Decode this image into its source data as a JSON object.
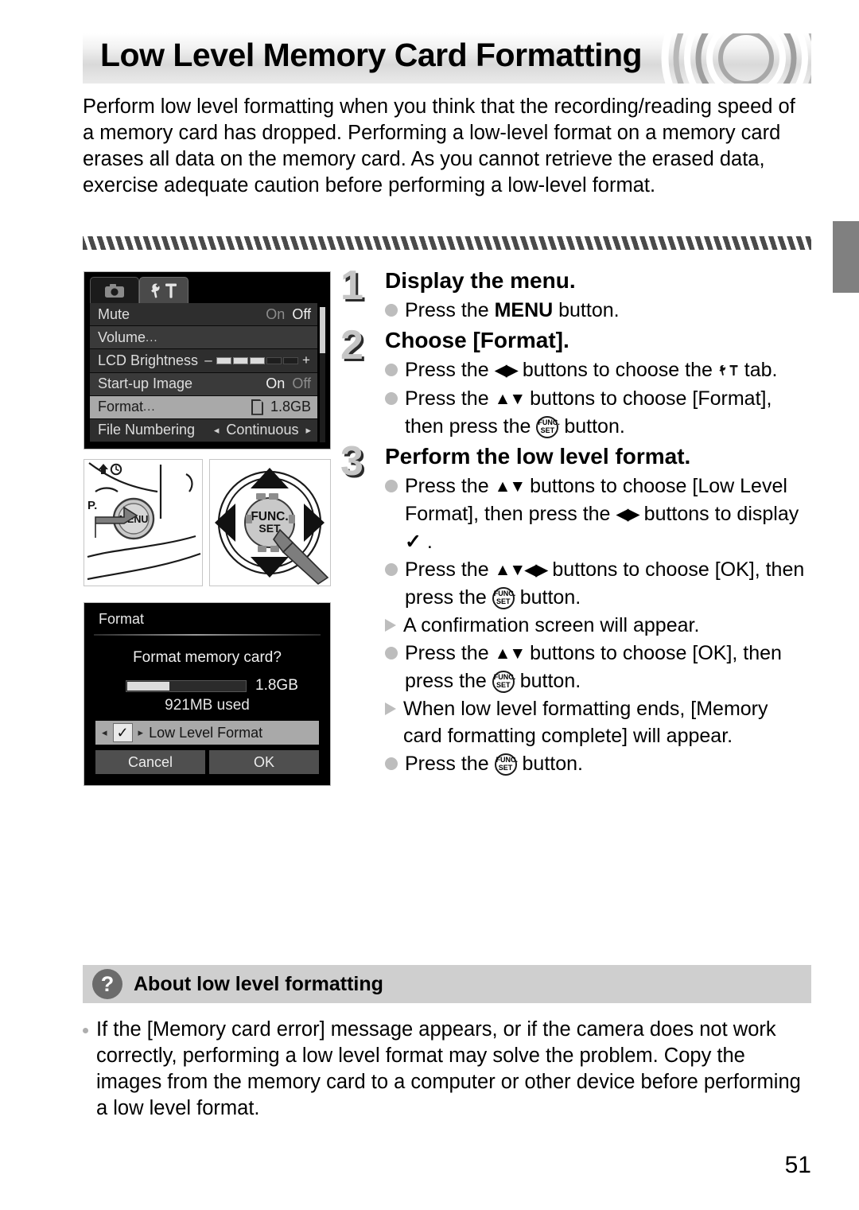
{
  "header": {
    "title": "Low Level Memory Card Formatting"
  },
  "intro": "Perform low level formatting when you think that the recording/reading speed of a memory card has dropped. Performing a low-level format on a memory card erases all data on the memory card. As you cannot retrieve the erased data, exercise adequate caution before performing a low-level format.",
  "menu_screen": {
    "tabs": [
      {
        "icon": "camera-icon",
        "active": false
      },
      {
        "icon": "tools-icon",
        "active": true
      }
    ],
    "rows": [
      {
        "label": "Mute",
        "value_on": "On",
        "value_off": "Off",
        "selected": "Off"
      },
      {
        "label": "Volume",
        "ellipsis": "..."
      },
      {
        "label": "LCD Brightness",
        "minus": "–",
        "plus": "+",
        "segments_lit": 3,
        "segments_total": 5
      },
      {
        "label": "Start-up Image",
        "value_on": "On",
        "value_off": "Off",
        "selected": "On"
      },
      {
        "label": "Format",
        "ellipsis": "...",
        "value": "1.8GB",
        "icon": "sd-card-icon",
        "highlighted": true
      },
      {
        "label": "File Numbering",
        "value": "Continuous",
        "left_arrow": "◂",
        "right_arrow": "▸"
      }
    ]
  },
  "illustrations": {
    "menu_button": {
      "name": "camera-back-menu-button",
      "label": "MENU",
      "mode_label": "P."
    },
    "func_button": {
      "name": "camera-four-way-controller",
      "label_top": "FUNC.",
      "label_bottom": "SET"
    }
  },
  "format_screen": {
    "title": "Format",
    "question": "Format memory card?",
    "capacity": "1.8GB",
    "used": "921MB used",
    "low_level_label": "Low Level Format",
    "check_glyph": "✓",
    "left_arrow": "◂",
    "right_arrow": "▸",
    "cancel": "Cancel",
    "ok": "OK",
    "bar_fill_percent": 35
  },
  "steps": [
    {
      "number": "1",
      "heading": "Display the menu.",
      "lines": [
        {
          "marker": "dot",
          "parts": [
            {
              "t": "text",
              "v": "Press the "
            },
            {
              "t": "menu-glyph",
              "v": "MENU"
            },
            {
              "t": "text",
              "v": " button."
            }
          ]
        }
      ]
    },
    {
      "number": "2",
      "heading": "Choose [Format].",
      "lines": [
        {
          "marker": "dot",
          "parts": [
            {
              "t": "text",
              "v": "Press the "
            },
            {
              "t": "lr-glyph",
              "v": "◀▶"
            },
            {
              "t": "text",
              "v": " buttons to choose the "
            },
            {
              "t": "tools-glyph",
              "v": "⚙"
            },
            {
              "t": "text",
              "v": " tab."
            }
          ]
        },
        {
          "marker": "dot",
          "parts": [
            {
              "t": "text",
              "v": "Press the "
            },
            {
              "t": "ud-glyph",
              "v": "▲▼"
            },
            {
              "t": "text",
              "v": " buttons to choose [Format], then press the "
            },
            {
              "t": "func-glyph",
              "v": "FUNC.SET"
            },
            {
              "t": "text",
              "v": " button."
            }
          ]
        }
      ]
    },
    {
      "number": "3",
      "heading": "Perform the low level format.",
      "lines": [
        {
          "marker": "dot",
          "parts": [
            {
              "t": "text",
              "v": "Press the "
            },
            {
              "t": "ud-glyph",
              "v": "▲▼"
            },
            {
              "t": "text",
              "v": " buttons to choose [Low Level Format], then press the "
            },
            {
              "t": "lr-glyph",
              "v": "◀▶"
            },
            {
              "t": "text",
              "v": " buttons to display "
            },
            {
              "t": "check-glyph",
              "v": "✓"
            },
            {
              "t": "text",
              "v": " ."
            }
          ]
        },
        {
          "marker": "dot",
          "parts": [
            {
              "t": "text",
              "v": "Press the "
            },
            {
              "t": "ud-glyph",
              "v": "▲▼"
            },
            {
              "t": "lr-glyph",
              "v": "◀▶"
            },
            {
              "t": "text",
              "v": " buttons to choose [OK], then press the "
            },
            {
              "t": "func-glyph",
              "v": "FUNC.SET"
            },
            {
              "t": "text",
              "v": " button."
            }
          ]
        },
        {
          "marker": "triangle",
          "parts": [
            {
              "t": "text",
              "v": "A confirmation screen will appear."
            }
          ]
        },
        {
          "marker": "dot",
          "parts": [
            {
              "t": "text",
              "v": "Press the "
            },
            {
              "t": "ud-glyph",
              "v": "▲▼"
            },
            {
              "t": "text",
              "v": " buttons to choose [OK], then press the "
            },
            {
              "t": "func-glyph",
              "v": "FUNC.SET"
            },
            {
              "t": "text",
              "v": " button."
            }
          ]
        },
        {
          "marker": "triangle",
          "parts": [
            {
              "t": "text",
              "v": "When low level formatting ends, [Memory card formatting complete] will appear."
            }
          ]
        },
        {
          "marker": "dot",
          "parts": [
            {
              "t": "text",
              "v": "Press the "
            },
            {
              "t": "func-glyph",
              "v": "FUNC.SET"
            },
            {
              "t": "text",
              "v": " button."
            }
          ]
        }
      ]
    }
  ],
  "about": {
    "icon": "question-mark-icon",
    "title": "About low level formatting",
    "body": "If the [Memory card error] message appears, or if the camera does not work correctly, performing a low level format may solve the problem. Copy the images from the memory card to a computer or other device before performing a low level format."
  },
  "page_number": "51",
  "colors": {
    "accent_gray": "#cfcfcf",
    "tab_gray": "#808080",
    "selection_gray": "#a9a9a9"
  }
}
